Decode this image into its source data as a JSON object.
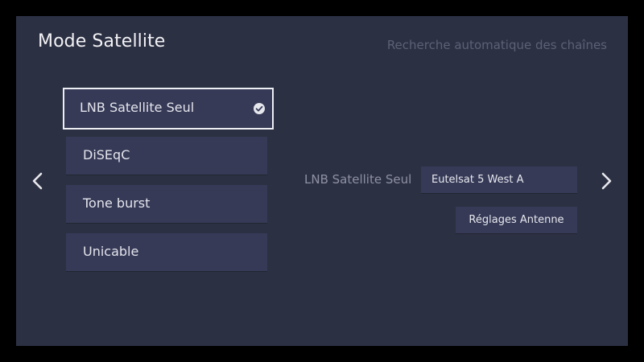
{
  "header": {
    "title": "Mode Satellite",
    "subtitle": "Recherche automatique des chaînes"
  },
  "nav": {
    "left_icon": "chevron-left-icon",
    "right_icon": "chevron-right-icon"
  },
  "modes": {
    "selected_index": 0,
    "items": [
      {
        "label": "LNB Satellite Seul",
        "selected": true
      },
      {
        "label": "DiSEqC",
        "selected": false
      },
      {
        "label": "Tone burst",
        "selected": false
      },
      {
        "label": "Unicable",
        "selected": false
      }
    ],
    "selected_icon": "check-circle-icon"
  },
  "detail": {
    "label": "LNB Satellite Seul",
    "satellite_value": "Eutelsat 5 West A",
    "antenna_button_label": "Réglages Antenne"
  },
  "colors": {
    "background": "#2c3043",
    "tile": "#363a57",
    "text": "#e4e5ec",
    "muted_text": "#8e91a3",
    "subtitle_text": "#5d6176",
    "focus_border": "#eceef3"
  }
}
